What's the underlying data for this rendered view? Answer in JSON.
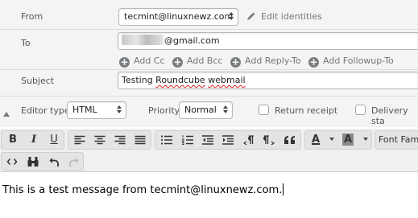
{
  "headers": {
    "from": {
      "label": "From",
      "value": "tecmint@linuxnewz.com",
      "edit_identities": "Edit identities"
    },
    "to": {
      "label": "To",
      "visible_value": "@gmail.com"
    },
    "add_links": [
      "Add Cc",
      "Add Bcc",
      "Add Reply-To",
      "Add Followup-To"
    ],
    "subject": {
      "label": "Subject",
      "value_word1": "Testing",
      "value_word2": "Roundcube",
      "value_word3": "webmail"
    }
  },
  "options": {
    "editor_type_label": "Editor type",
    "editor_type_value": "HTML",
    "priority_label": "Priority",
    "priority_value": "Normal",
    "return_receipt": "Return receipt",
    "delivery_status": "Delivery sta"
  },
  "toolbar": {
    "bold": "B",
    "italic": "I",
    "underline": "U",
    "font_family": "Font Fam",
    "text_color": "A",
    "bg_color": "A"
  },
  "message": {
    "body": "This is a test message from tecmint@linuxnewz.com."
  }
}
